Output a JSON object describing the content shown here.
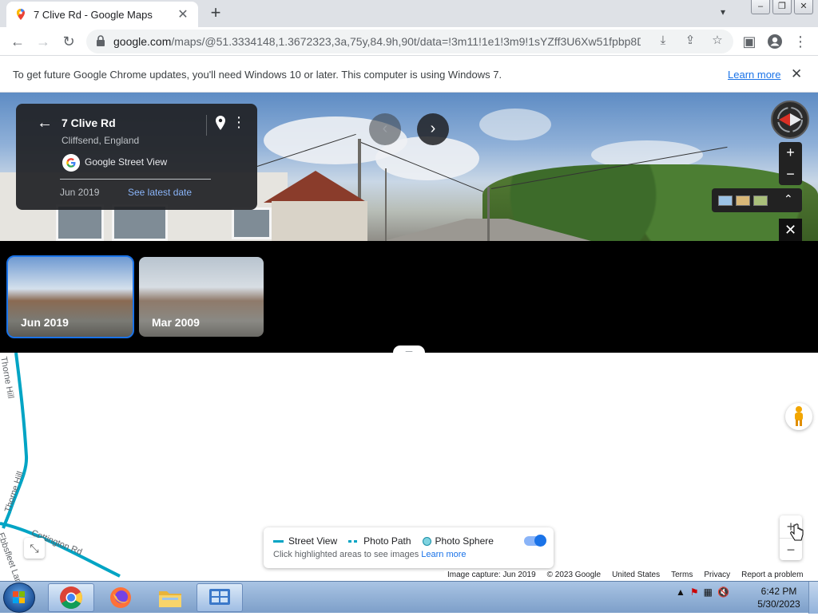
{
  "browser": {
    "tab_title": "7 Clive Rd - Google Maps",
    "new_tab_label": "+",
    "url_host": "google.com",
    "url_rest": "/maps/@51.3334148,1.3672323,3a,75y,84.9h,90t/data=!3m11!1e1!3m9!1sYZff3U6Xw51fpbp8D..."
  },
  "infobar": {
    "message": "To get future Google Chrome updates, you'll need Windows 10 or later. This computer is using Windows 7.",
    "link": "Learn more"
  },
  "streetview": {
    "title": "7 Clive Rd",
    "subtitle": "Cliffsend, England",
    "source": "Google Street View",
    "date": "Jun 2019",
    "latest_link": "See latest date"
  },
  "timeline": {
    "items": [
      {
        "label": "Jun 2019",
        "selected": true
      },
      {
        "label": "Mar 2009",
        "selected": false
      }
    ]
  },
  "map": {
    "road_labels": [
      "Thorne Hill",
      "Thorne Hill",
      "Cottington Rd",
      "Ebbsfleet Lane"
    ]
  },
  "legend": {
    "street_view": "Street View",
    "photo_path": "Photo Path",
    "photo_sphere": "Photo Sphere",
    "help_text": "Click highlighted areas to see images",
    "help_link": "Learn more",
    "toggle_on": true
  },
  "footer": {
    "capture": "Image capture: Jun 2019",
    "copyright": "© 2023 Google",
    "region": "United States",
    "terms": "Terms",
    "privacy": "Privacy",
    "report": "Report a problem"
  },
  "taskbar": {
    "time": "6:42 PM",
    "date": "5/30/2023"
  },
  "colors": {
    "accent": "#1a73e8",
    "coverage_line": "#00a4c4"
  }
}
